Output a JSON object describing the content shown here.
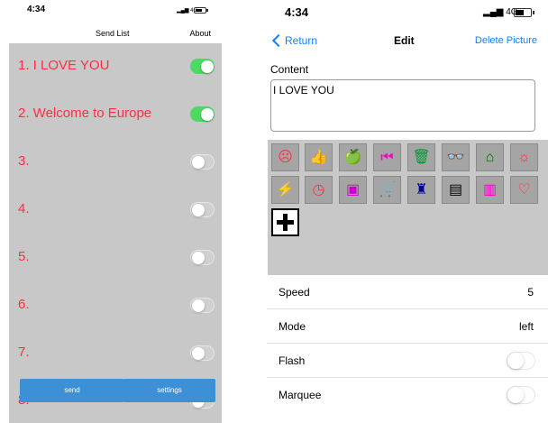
{
  "left_screen": {
    "status": {
      "time": "4:34",
      "network": "4G"
    },
    "nav": {
      "title": "Send List",
      "about": "About"
    },
    "items": [
      {
        "label": "1. I LOVE YOU",
        "enabled": true
      },
      {
        "label": "2. Welcome to Europe",
        "enabled": true
      },
      {
        "label": "3.",
        "enabled": false
      },
      {
        "label": "4.",
        "enabled": false
      },
      {
        "label": "5.",
        "enabled": false
      },
      {
        "label": "6.",
        "enabled": false
      },
      {
        "label": "7.",
        "enabled": false
      },
      {
        "label": "8.",
        "enabled": false
      }
    ],
    "buttons": {
      "send": "send",
      "settings": "settings"
    },
    "colors": {
      "item_text": "#ff2d46",
      "toggle_on": "#4cd964",
      "button": "#3d8fd6",
      "list_bg": "#c8c8c8"
    }
  },
  "right_screen": {
    "status": {
      "time": "4:34",
      "network": "4G"
    },
    "nav": {
      "back": "Return",
      "title": "Edit",
      "delete": "Delete Picture"
    },
    "content": {
      "label": "Content",
      "value": "I LOVE YOU"
    },
    "icons": [
      {
        "name": "face-icon",
        "glyph": "☹",
        "color": "#ff2d46"
      },
      {
        "name": "thumbs-up-icon",
        "glyph": "👍",
        "color": "#e6c300"
      },
      {
        "name": "apple-icon",
        "glyph": "🍏",
        "color": "#33cc33"
      },
      {
        "name": "skip-back-icon",
        "glyph": "⏮",
        "color": "#ff00cc"
      },
      {
        "name": "trash-icon",
        "glyph": "🗑",
        "color": "#009933"
      },
      {
        "name": "glasses-icon",
        "glyph": "👓",
        "color": "#00e5ff"
      },
      {
        "name": "home-icon",
        "glyph": "⌂",
        "color": "#006600"
      },
      {
        "name": "sun-icon",
        "glyph": "☼",
        "color": "#ff2d46"
      },
      {
        "name": "lightning-icon",
        "glyph": "⚡",
        "color": "#0022ff"
      },
      {
        "name": "clock-icon",
        "glyph": "◷",
        "color": "#ff2d46"
      },
      {
        "name": "chat-icon",
        "glyph": "▣",
        "color": "#cc00cc"
      },
      {
        "name": "cart-icon",
        "glyph": "🛒",
        "color": "#33cc33"
      },
      {
        "name": "castle-icon",
        "glyph": "♜",
        "color": "#000099"
      },
      {
        "name": "computer-icon",
        "glyph": "▤",
        "color": "#000000"
      },
      {
        "name": "disk-icon",
        "glyph": "▥",
        "color": "#ff00cc"
      },
      {
        "name": "heart-icon",
        "glyph": "♡",
        "color": "#ff2d46"
      }
    ],
    "settings": [
      {
        "label": "Speed",
        "value": "5"
      },
      {
        "label": "Mode",
        "value": "left"
      },
      {
        "label": "Flash",
        "toggle": false
      },
      {
        "label": "Marquee",
        "toggle": false
      }
    ],
    "colors": {
      "link": "#147efb",
      "grid_bg": "#c8c8c8",
      "cell_bg": "#a5a5a5"
    }
  }
}
